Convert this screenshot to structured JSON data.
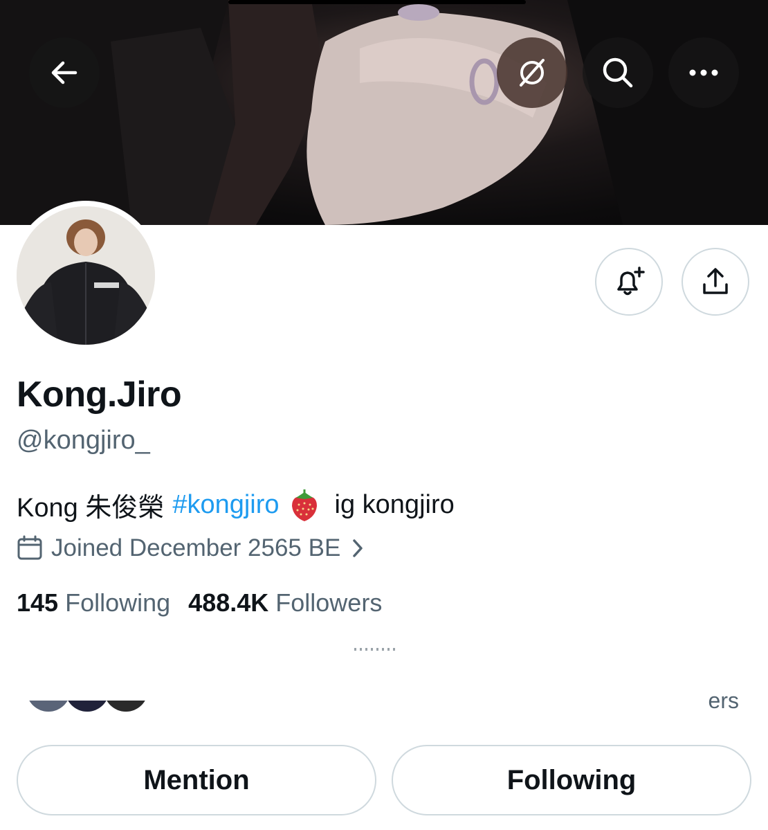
{
  "header": {
    "back_icon": "arrow-left-icon",
    "grok_icon": "grok-icon",
    "search_icon": "search-icon",
    "more_icon": "more-horizontal-icon"
  },
  "profile": {
    "actions": {
      "notify_icon": "bell-plus-icon",
      "share_icon": "share-upload-icon"
    },
    "display_name": "Kong.Jiro",
    "handle": "@kongjiro_",
    "bio": {
      "prefix": "Kong 朱俊榮",
      "hashtag": "#kongjiro",
      "emoji": "strawberry",
      "suffix": "ig kongjiro"
    },
    "joined": "Joined December 2565 BE",
    "following_count": "145",
    "following_label": "Following",
    "followers_count": "488.4K",
    "followers_label": "Followers",
    "followed_by_fragment": "ers"
  },
  "buttons": {
    "mention": "Mention",
    "following": "Following"
  },
  "colors": {
    "link": "#1d9bf0",
    "secondary_text": "#536471",
    "border": "#cfd9de"
  }
}
